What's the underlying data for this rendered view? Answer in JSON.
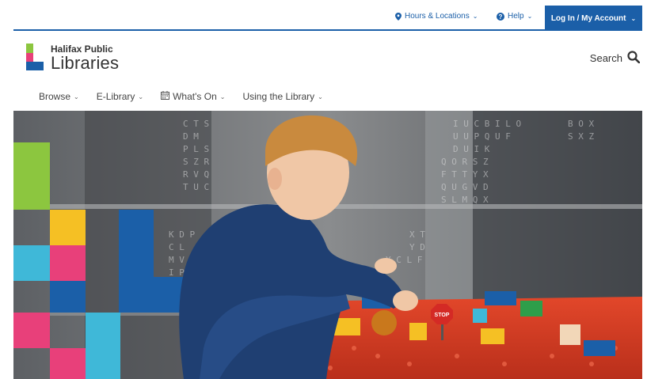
{
  "utility": {
    "hours_label": "Hours & Locations",
    "help_label": "Help",
    "account_label": "Log In / My Account"
  },
  "header": {
    "logo_line1": "Halifax Public",
    "logo_line2": "Libraries",
    "search_label": "Search"
  },
  "nav": {
    "items": [
      {
        "label": "Browse"
      },
      {
        "label": "E-Library"
      },
      {
        "label": "What's On"
      },
      {
        "label": "Using the Library"
      }
    ]
  },
  "hero": {
    "sign_text": "STOP"
  },
  "colors": {
    "brand_blue": "#1b5fa8",
    "logo_green": "#8cc63f",
    "logo_pink": "#e8407a",
    "logo_blue": "#1b5fa8"
  },
  "icons": {
    "hours": "map-pin-icon",
    "help": "help-circle-icon",
    "search": "search-icon",
    "calendar": "calendar-icon"
  }
}
